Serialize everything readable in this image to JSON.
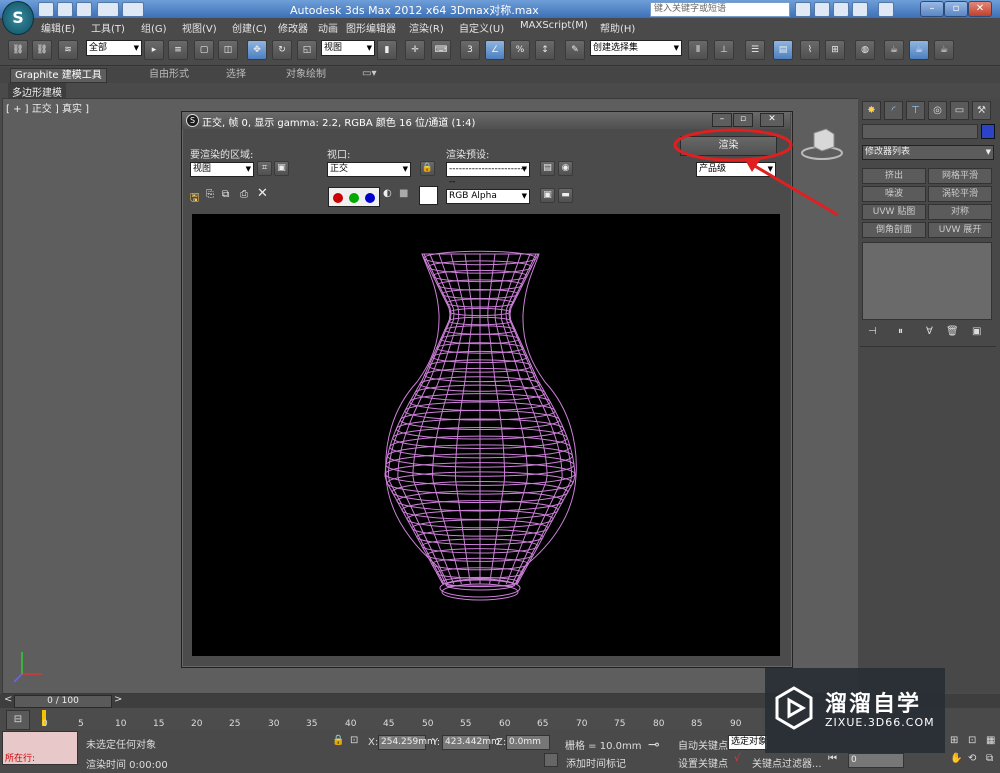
{
  "app": {
    "window_title": "Autodesk 3ds Max  2012 x64      3Dmax对称.max",
    "search_placeholder": "键入关键字或短语"
  },
  "menus": [
    "编辑(E)",
    "工具(T)",
    "组(G)",
    "视图(V)",
    "创建(C)",
    "修改器",
    "动画",
    "图形编辑器",
    "渲染(R)",
    "自定义(U)",
    "MAXScript(M)",
    "帮助(H)"
  ],
  "toolbar": {
    "selection_filter": "全部",
    "reference_coord": "视图",
    "named_selection": "创建选择集",
    "snap_labels": [
      "3",
      "%"
    ]
  },
  "ribbon": {
    "tabs": [
      "Graphite 建模工具",
      "自由形式",
      "选择",
      "对象绘制"
    ],
    "sub_label": "多边形建模"
  },
  "viewport": {
    "label": "[ + ] 正交 ] 真实 ]"
  },
  "command_panel": {
    "modifier_list": "修改器列表",
    "buttons": [
      "挤出",
      "网格平滑",
      "噪波",
      "涡轮平滑",
      "UVW 贴图",
      "对称",
      "倒角剖面",
      "UVW 展开"
    ]
  },
  "render_window": {
    "title": "正交, 帧 0, 显示 gamma: 2.2, RGBA 颜色 16 位/通道 (1:4)",
    "area_label": "要渲染的区域:",
    "area_value": "视图",
    "viewport_label": "视口:",
    "viewport_value": "正交",
    "preset_label": "渲染预设:",
    "preset_value": "--------------------------",
    "render_button": "渲染",
    "quality_value": "产品级",
    "channel_value": "RGB Alpha",
    "colors": {
      "red": "#cc0000",
      "green": "#00aa00",
      "blue": "#0000cc",
      "wire": "#e38ef0"
    }
  },
  "timeline": {
    "frame_counter": "0 / 100",
    "ticks": [
      "0",
      "5",
      "10",
      "15",
      "20",
      "25",
      "30",
      "35",
      "40",
      "45",
      "50",
      "55",
      "60",
      "65",
      "70",
      "75",
      "80",
      "85",
      "90"
    ]
  },
  "status": {
    "location_label": "所在行:",
    "selection_status": "未选定任何对象",
    "render_time": "渲染时间 0:00:00",
    "x_label": "X:",
    "x_value": "254.259mm",
    "y_label": "Y:",
    "y_value": "423.442mm",
    "z_label": "Z:",
    "z_value": "0.0mm",
    "grid": "栅格 = 10.0mm",
    "add_time_tag": "添加时间标记",
    "auto_key": "自动关键点",
    "auto_key_value": "选定对象",
    "set_key": "设置关键点",
    "key_filter": "关键点过滤器...",
    "frame_value": "0"
  },
  "watermark": {
    "title": "溜溜自学",
    "subtitle": "ZIXUE.3D66.COM"
  }
}
